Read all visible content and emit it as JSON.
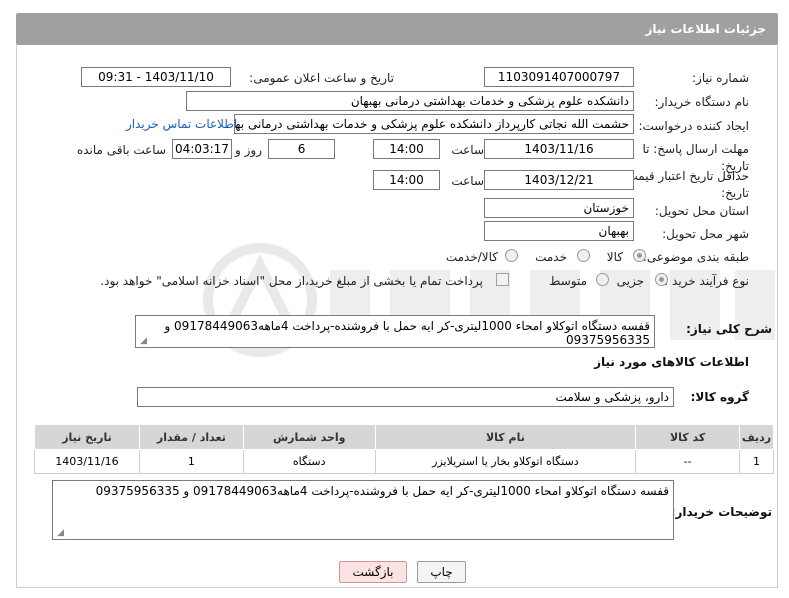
{
  "header": {
    "title": "جزئیات اطلاعات نیاز"
  },
  "fields": {
    "need_number_label": "شماره نیاز:",
    "need_number": "1103091407000797",
    "announce_label": "تاریخ و ساعت اعلان عمومی:",
    "announce_value": "1403/11/10 - 09:31",
    "buyer_org_label": "نام دستگاه خریدار:",
    "buyer_org": "دانشکده علوم پزشکی و خدمات بهداشتی  درمانی بهبهان",
    "creator_label": "ایجاد کننده درخواست:",
    "creator": "حشمت الله نجاتی کارپرداز دانشکده علوم پزشکی و خدمات بهداشتی  درمانی بهبهان",
    "contact_link": "اطلاعات تماس خریدار",
    "reply_deadline_label": "مهلت ارسال پاسخ: تا تاریخ:",
    "reply_date": "1403/11/16",
    "time_label": "ساعت",
    "reply_time": "14:00",
    "days_value": "6",
    "days_label": "روز و",
    "remaining_time": "04:03:17",
    "remaining_label": "ساعت باقی مانده",
    "price_validity_label": "حداقل تاریخ اعتبار قیمت: تا تاریخ:",
    "price_date": "1403/12/21",
    "price_time": "14:00",
    "province_label": "استان محل تحویل:",
    "province": "خوزستان",
    "city_label": "شهر محل تحویل:",
    "city": "بهبهان",
    "category_label": "طبقه بندی موضوعی:",
    "category_options": [
      "کالا",
      "خدمت",
      "کالا/خدمت"
    ],
    "purchase_type_label": "نوع فرآیند خرید :",
    "purchase_options": [
      "جزیی",
      "متوسط"
    ],
    "purchase_note": "پرداخت تمام یا بخشی از مبلغ خرید،از محل \"اسناد خزانه اسلامی\" خواهد بود.",
    "description_label": "شرح کلی نیاز:",
    "description": "قفسه دستگاه اتوکلاو امحاء 1000لیتری-کر ایه حمل با فروشنده-پرداخت 4ماهه09178449063 و 09375956335",
    "goods_info_title": "اطلاعات کالاهای مورد نیاز",
    "goods_group_label": "گروه کالا:",
    "goods_group": "دارو، پزشکی و سلامت",
    "buyer_notes_label": "توضیحات خریدار:",
    "buyer_notes": "قفسه دستگاه اتوکلاو امحاء 1000لیتری-کر ایه حمل با فروشنده-پرداخت 4ماهه09178449063 و 09375956335"
  },
  "table": {
    "headers": [
      "ردیف",
      "کد کالا",
      "نام کالا",
      "واحد شمارش",
      "تعداد / مقدار",
      "تاریخ نیاز"
    ],
    "rows": [
      [
        "1",
        "--",
        "دستگاه اتوکلاو بخار یا استریلایزر",
        "دستگاه",
        "1",
        "1403/11/16"
      ]
    ]
  },
  "buttons": {
    "print": "چاپ",
    "back": "بازگشت"
  },
  "colors": {
    "header_bg": "#a0a0a0",
    "link": "#1a5fb4",
    "back_button_bg": "#fbe3e3"
  }
}
